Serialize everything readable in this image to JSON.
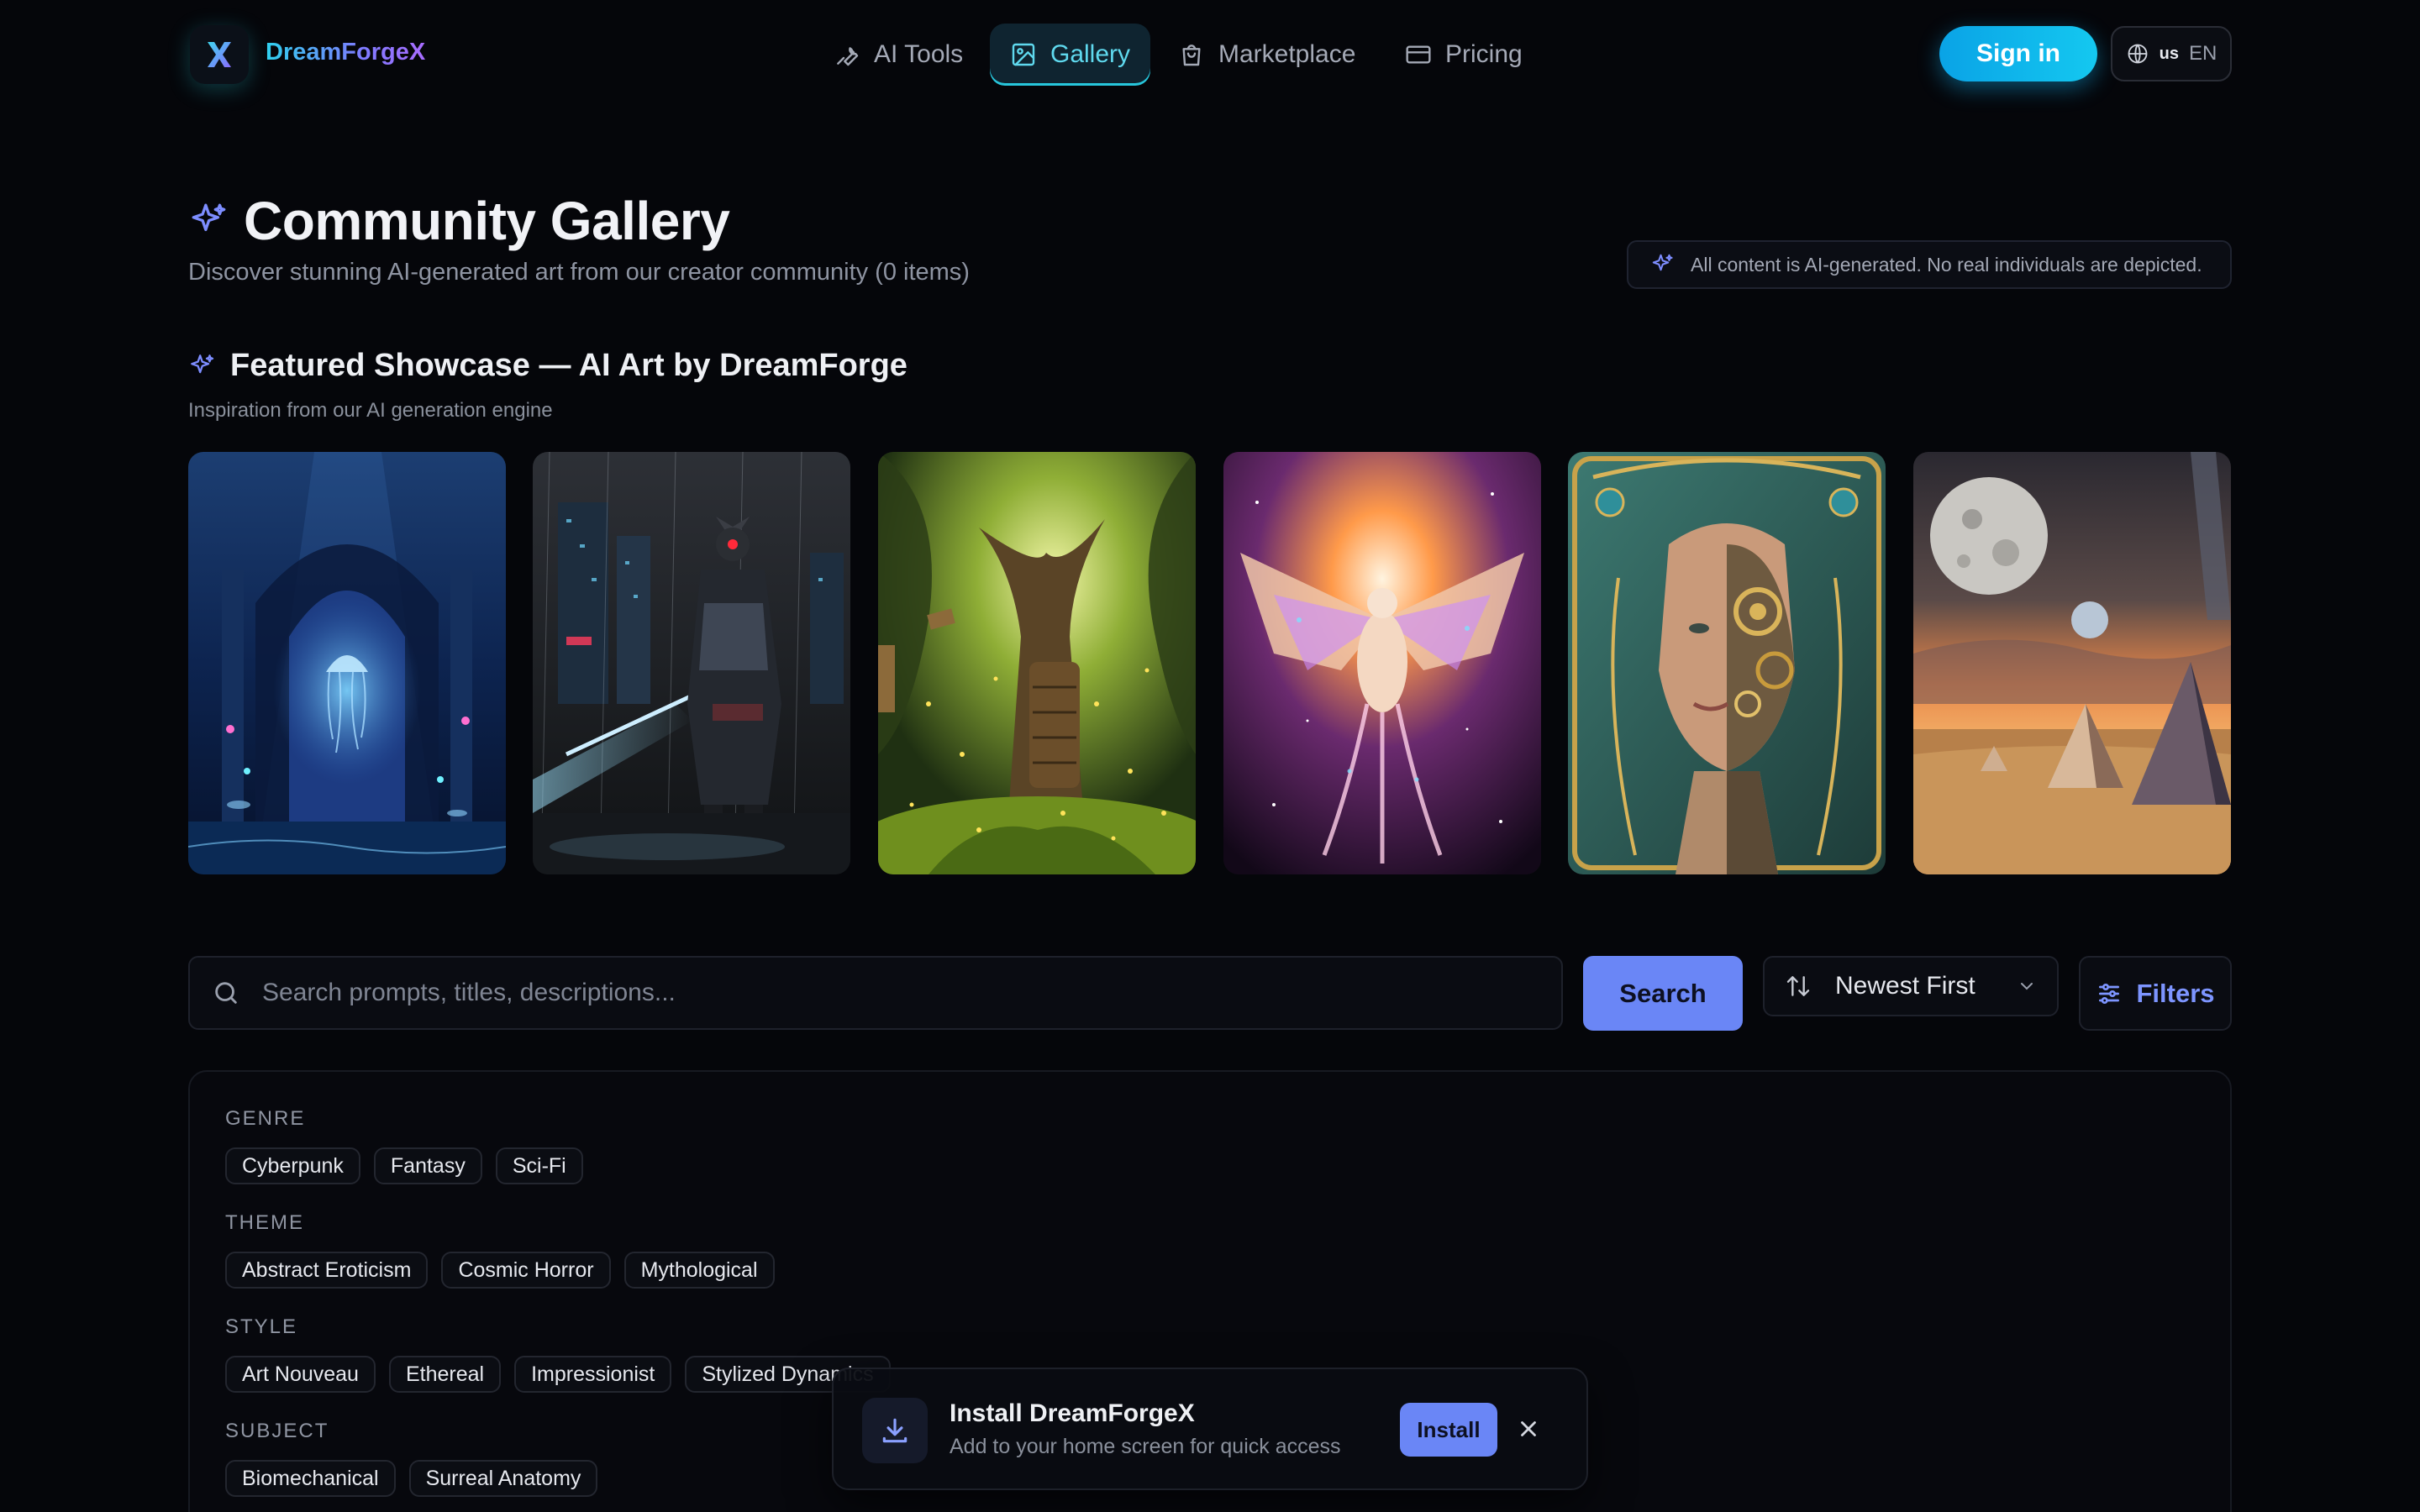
{
  "nav": {
    "brand": "DreamForgeX",
    "items": [
      {
        "label": "AI Tools",
        "icon": "wrench-icon"
      },
      {
        "label": "Gallery",
        "icon": "image-icon",
        "active": true
      },
      {
        "label": "Marketplace",
        "icon": "shopping-bag-icon"
      },
      {
        "label": "Pricing",
        "icon": "credit-card-icon"
      }
    ],
    "sign_in": "Sign in",
    "lang_flag": "us",
    "lang_code": "EN"
  },
  "header": {
    "title": "Community Gallery",
    "subtitle": "Discover stunning AI-generated art from our creator community (0 items)",
    "notice": "All content is AI-generated. No real individuals are depicted."
  },
  "featured": {
    "title": "Featured Showcase — AI Art by DreamForge",
    "subtitle": "Inspiration from our AI generation engine",
    "cards": [
      {
        "subject": "underwater-cathedral-jellyfish"
      },
      {
        "subject": "cyber-samurai-in-rain-city"
      },
      {
        "subject": "enchanted-forest-library-tree"
      },
      {
        "subject": "crystal-phoenix-nebula"
      },
      {
        "subject": "art-nouveau-clockwork-woman"
      },
      {
        "subject": "desert-moon-crystal-pyramids"
      }
    ]
  },
  "search": {
    "placeholder": "Search prompts, titles, descriptions...",
    "button": "Search",
    "sort_value": "Newest First",
    "filters_button": "Filters"
  },
  "filters": [
    {
      "label": "GENRE",
      "chips": [
        "Cyberpunk",
        "Fantasy",
        "Sci-Fi"
      ]
    },
    {
      "label": "THEME",
      "chips": [
        "Abstract Eroticism",
        "Cosmic Horror",
        "Mythological"
      ]
    },
    {
      "label": "STYLE",
      "chips": [
        "Art Nouveau",
        "Ethereal",
        "Impressionist",
        "Stylized Dynamics"
      ]
    },
    {
      "label": "SUBJECT",
      "chips": [
        "Biomechanical",
        "Surreal Anatomy"
      ]
    }
  ],
  "install": {
    "title": "Install DreamForgeX",
    "subtitle": "Add to your home screen for quick access",
    "button": "Install"
  },
  "colors": {
    "background": "#05060a",
    "accent_cyan": "#14c8f0",
    "accent_indigo": "#6a86f6",
    "gallery_active": "#5fd9ee"
  }
}
